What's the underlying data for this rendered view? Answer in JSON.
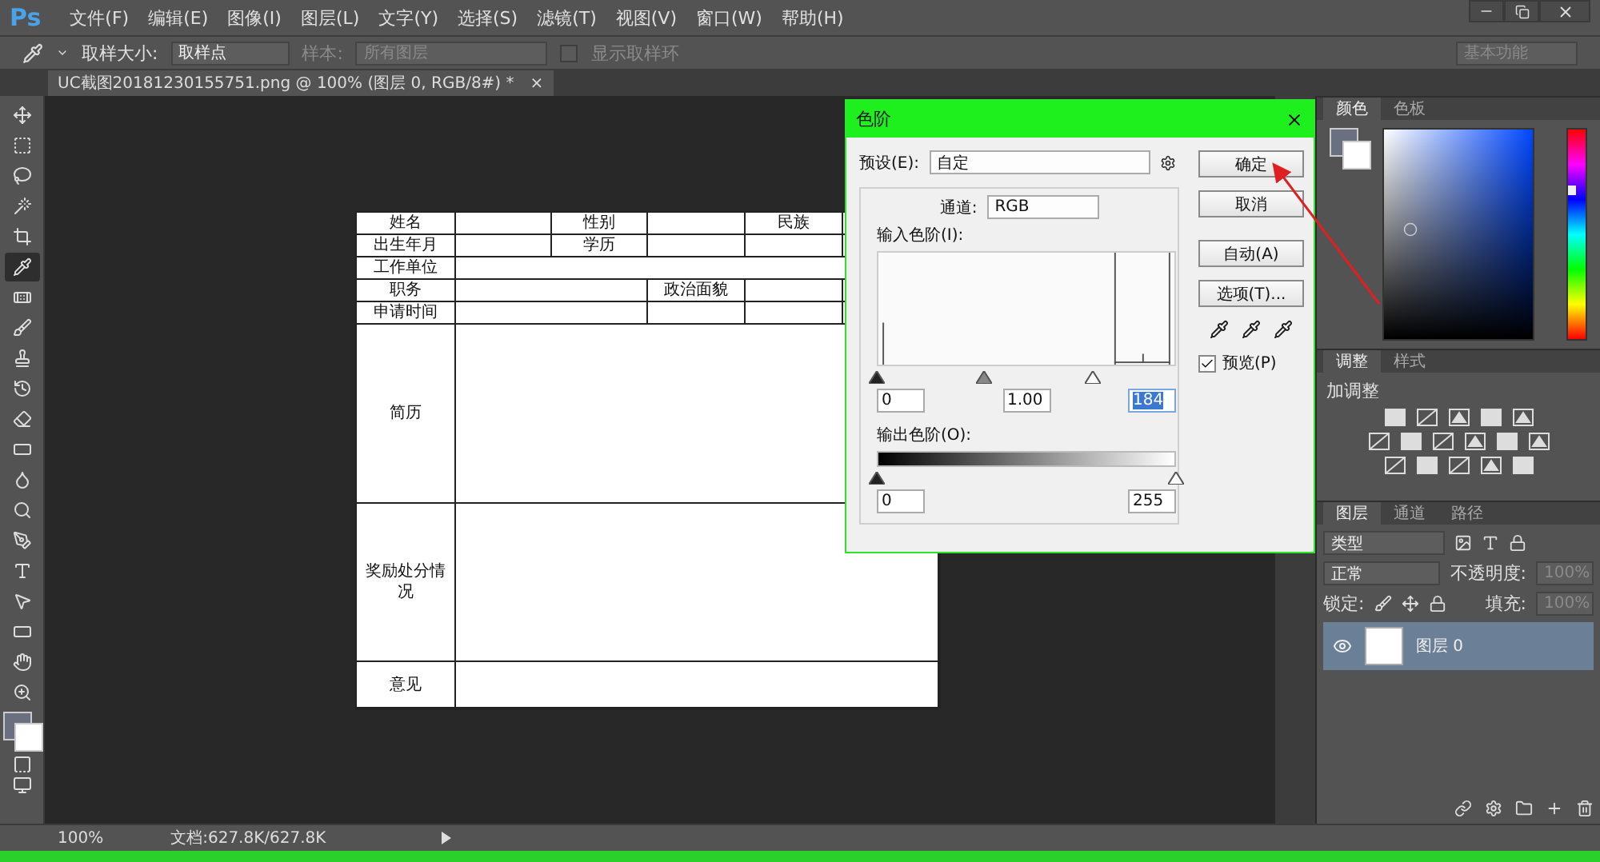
{
  "menu_bar": {
    "logo": "Ps",
    "items": [
      "文件(F)",
      "编辑(E)",
      "图像(I)",
      "图层(L)",
      "文字(Y)",
      "选择(S)",
      "滤镜(T)",
      "视图(V)",
      "窗口(W)",
      "帮助(H)"
    ]
  },
  "options_bar": {
    "sample_size_label": "取样大小:",
    "sample_size": "取样点",
    "sample_label": "样本:",
    "sample": "所有图层",
    "sample_disabled": true,
    "ring_label": "显示取样环",
    "ring_checked": false,
    "workspace": "基本功能"
  },
  "document_tab": {
    "title": "UC截图20181230155751.png @ 100% (图层 0, RGB/8#) *",
    "close": "×"
  },
  "toolbar": {
    "tools": [
      {
        "kind": "move",
        "selected": false
      },
      {
        "kind": "marquee",
        "selected": false
      },
      {
        "kind": "lasso",
        "selected": false
      },
      {
        "kind": "wand",
        "selected": false
      },
      {
        "kind": "crop",
        "selected": false
      },
      {
        "kind": "eyedropper",
        "selected": true
      },
      {
        "kind": "heal",
        "selected": false
      },
      {
        "kind": "brush",
        "selected": false
      },
      {
        "kind": "stamp",
        "selected": false
      },
      {
        "kind": "history",
        "selected": false
      },
      {
        "kind": "eraser",
        "selected": false
      },
      {
        "kind": "gradient",
        "selected": false
      },
      {
        "kind": "blur",
        "selected": false
      },
      {
        "kind": "dodge",
        "selected": false
      },
      {
        "kind": "pen",
        "selected": false
      },
      {
        "kind": "type",
        "selected": false
      },
      {
        "kind": "select",
        "selected": false
      },
      {
        "kind": "shape",
        "selected": false
      },
      {
        "kind": "hand",
        "selected": false
      },
      {
        "kind": "zoom",
        "selected": false
      }
    ]
  },
  "document": {
    "table": {
      "rows": [
        {
          "kind": "grid",
          "label": "姓名",
          "item_b": "性别",
          "item_d": "民族"
        },
        {
          "kind": "grid",
          "label": "出生年月",
          "item_b": "学历"
        },
        {
          "kind": "full",
          "label": "工作单位"
        },
        {
          "kind": "split",
          "label": "职务",
          "item_c": "政治面貌"
        },
        {
          "kind": "split",
          "label": "申请时间"
        },
        {
          "kind": "full",
          "label": "简历"
        },
        {
          "kind": "full",
          "label": "奖励处分情况"
        },
        {
          "kind": "full",
          "label": "意见"
        }
      ]
    }
  },
  "levels_dialog": {
    "title": "色阶",
    "preset_label": "预设(E):",
    "preset": "自定",
    "channel_label": "通道:",
    "channel": "RGB",
    "input_label": "输入色阶(I):",
    "input_values": [
      {
        "value": "0",
        "selected": false
      },
      {
        "value": "1.00",
        "selected": false
      },
      {
        "value": "184",
        "selected": true
      }
    ],
    "output_label": "输出色阶(O):",
    "output_values": [
      {
        "value": "0",
        "selected": false
      },
      {
        "value": "255",
        "selected": false
      }
    ],
    "buttons": [
      "确定",
      "取消",
      "自动(A)",
      "选项(T)..."
    ],
    "preview_label": "预览(P)",
    "preview_checked": true
  },
  "color_panel": {
    "tabs": [
      {
        "label": "颜色",
        "selected": true
      },
      {
        "label": "色板",
        "selected": false
      }
    ],
    "hue": {
      "level": 0.71
    }
  },
  "adjustments_panel": {
    "tabs": [
      {
        "label": "调整",
        "selected": true
      },
      {
        "label": "样式",
        "selected": false
      }
    ],
    "hint": "加调整"
  },
  "layers_panel": {
    "tabs": [
      {
        "label": "图层",
        "selected": true
      },
      {
        "label": "通道",
        "selected": false
      },
      {
        "label": "路径",
        "selected": false
      }
    ],
    "filter": "类型",
    "blend_mode": "正常",
    "opacity_label": "不透明度:",
    "opacity": "100%",
    "lock_label": "锁定:",
    "fill_label": "填充:",
    "fill": "100%",
    "layers": [
      {
        "name": "图层 0",
        "selected": true,
        "visible": true
      }
    ]
  },
  "status_bar": {
    "zoom": "100%",
    "doc_info": "文档:627.8K/627.8K"
  }
}
